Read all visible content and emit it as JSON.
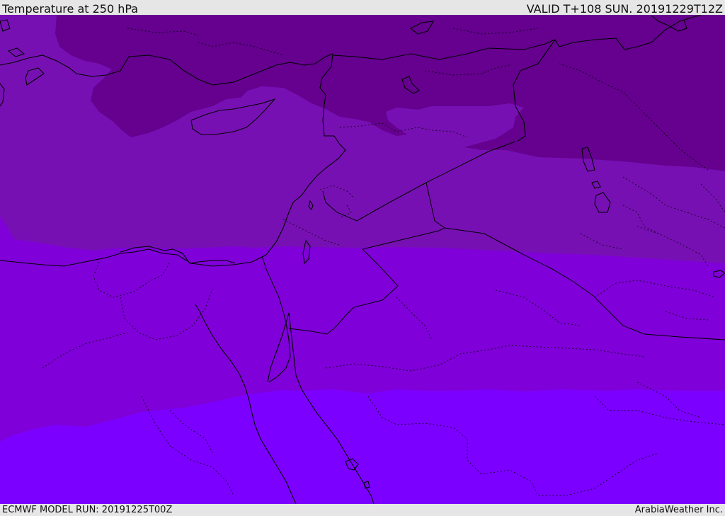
{
  "header": {
    "title": "Temperature at 250 hPa",
    "valid": "VALID T+108 SUN. 20191229T12Z"
  },
  "footer": {
    "model_run": "ECMWF MODEL RUN: 20191225T00Z",
    "credit": "ArabiaWeather Inc."
  },
  "colors": {
    "band_coldest": "#65008f",
    "band_cold": "#7710b3",
    "band_mid": "#7f00d8",
    "band_warm": "#7c00ff",
    "coast": "#000000"
  },
  "map": {
    "variable": "temperature",
    "pressure_level": "250 hPa",
    "region": "Eastern Mediterranean / Middle East"
  }
}
